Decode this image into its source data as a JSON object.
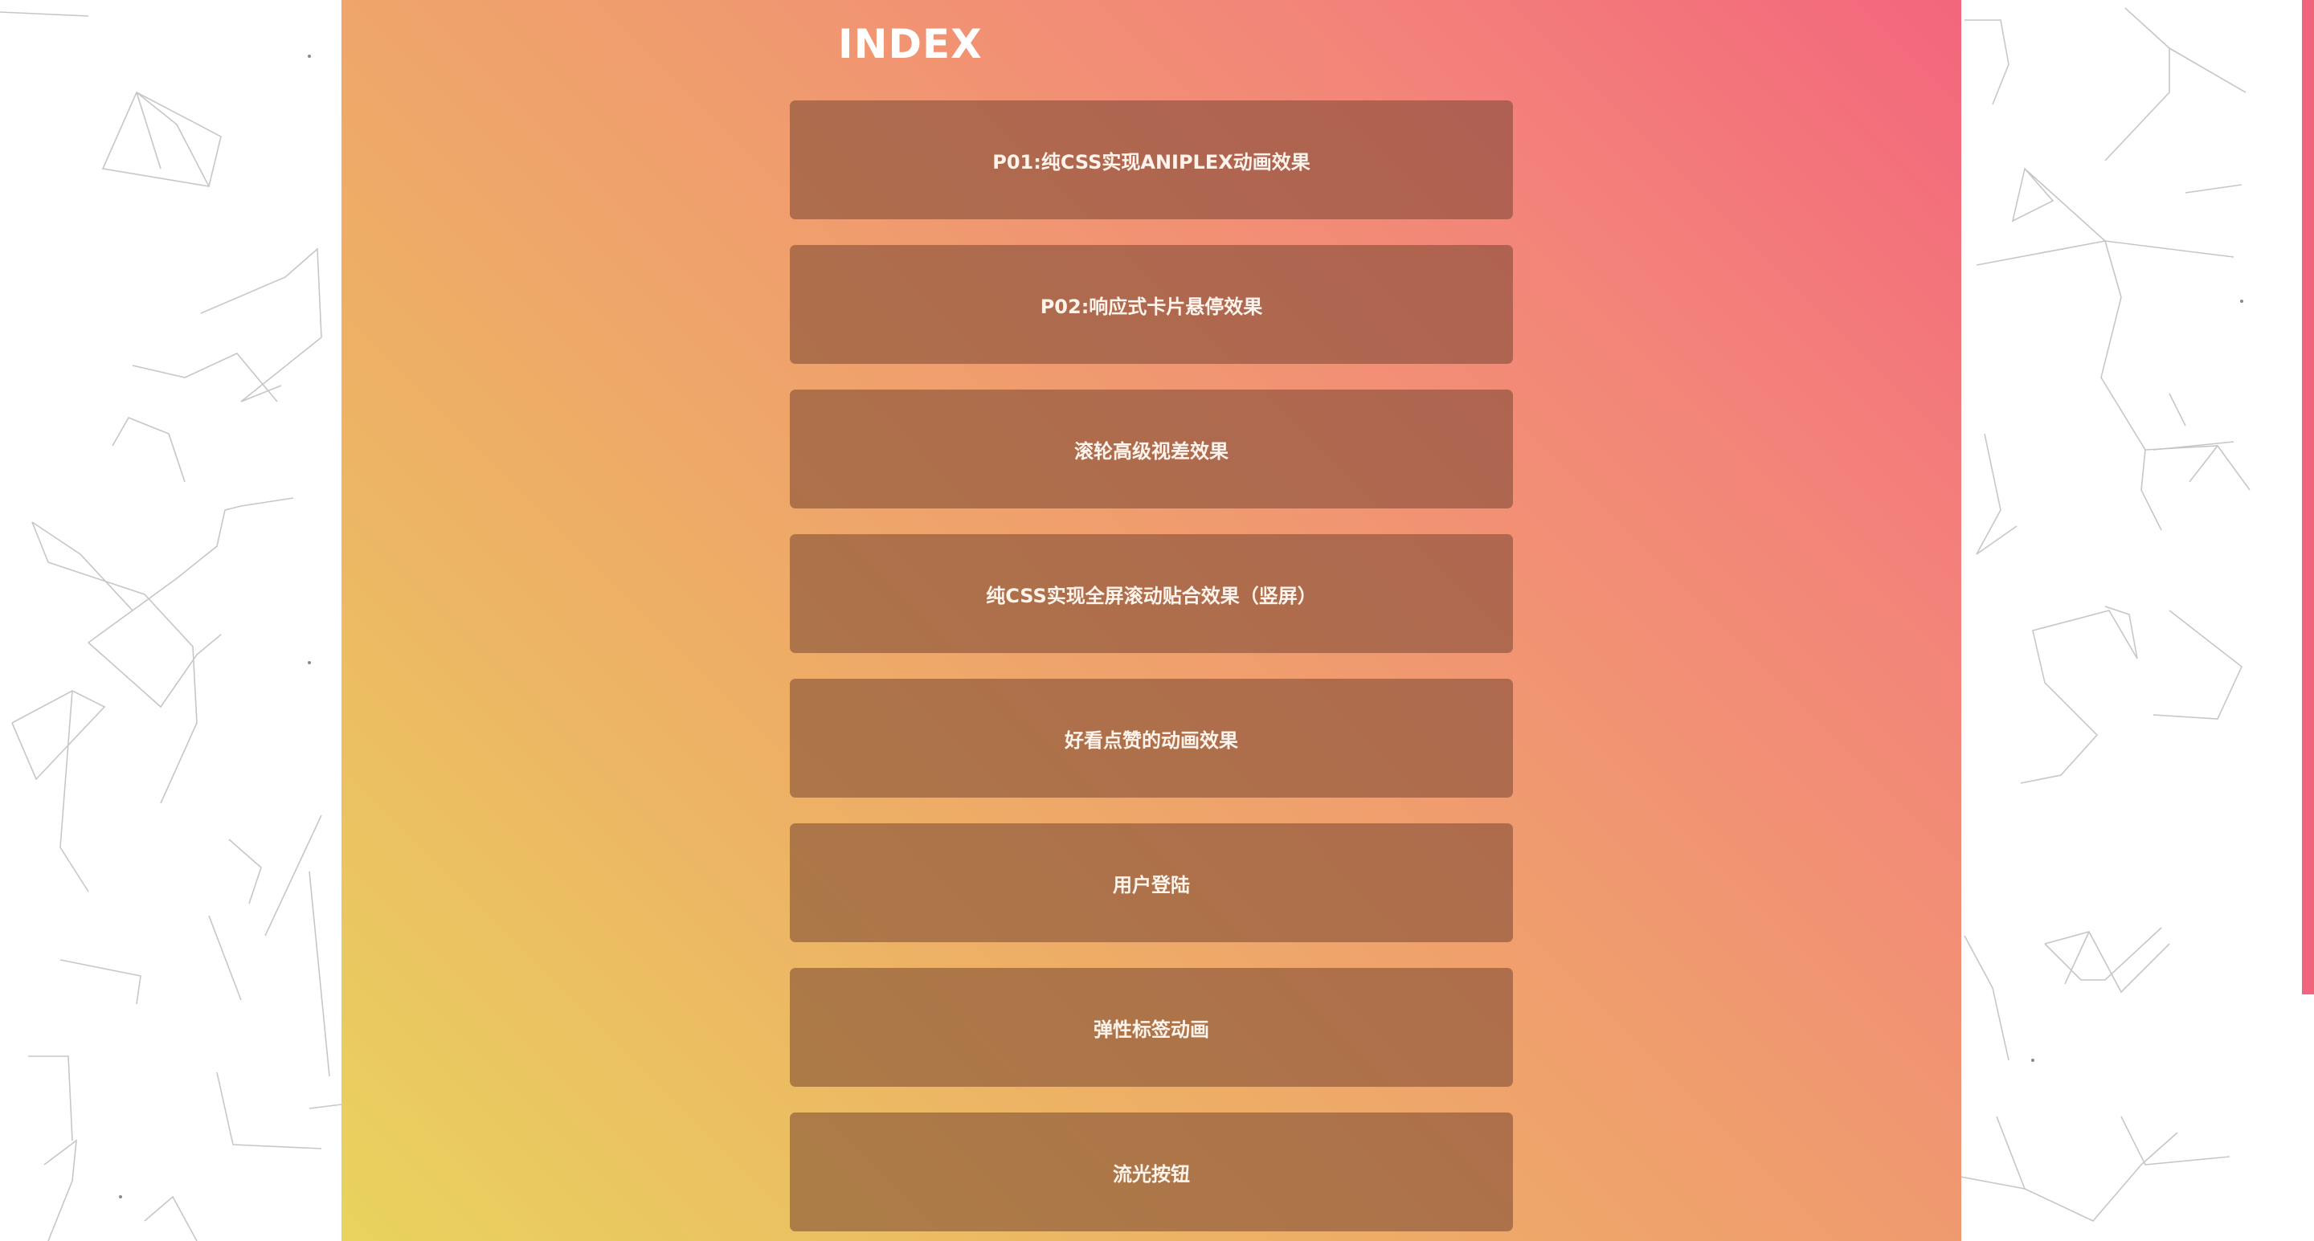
{
  "page": {
    "title": "INDEX"
  },
  "menu": {
    "items": [
      {
        "label": "P01:纯CSS实现ANIPLEX动画效果"
      },
      {
        "label": "P02:响应式卡片悬停效果"
      },
      {
        "label": "滚轮高级视差效果"
      },
      {
        "label": "纯CSS实现全屏滚动贴合效果（竖屏）"
      },
      {
        "label": "好看点赞的动画效果"
      },
      {
        "label": "用户登陆"
      },
      {
        "label": "弹性标签动画"
      },
      {
        "label": "流光按钮"
      }
    ]
  },
  "colors": {
    "gradient_top_right": "#f3667c",
    "gradient_bottom_left": "#e9d35e",
    "button_overlay": "rgba(120,70,50,0.55)",
    "text": "#ffffff",
    "accent_strip": "#f0647d"
  }
}
